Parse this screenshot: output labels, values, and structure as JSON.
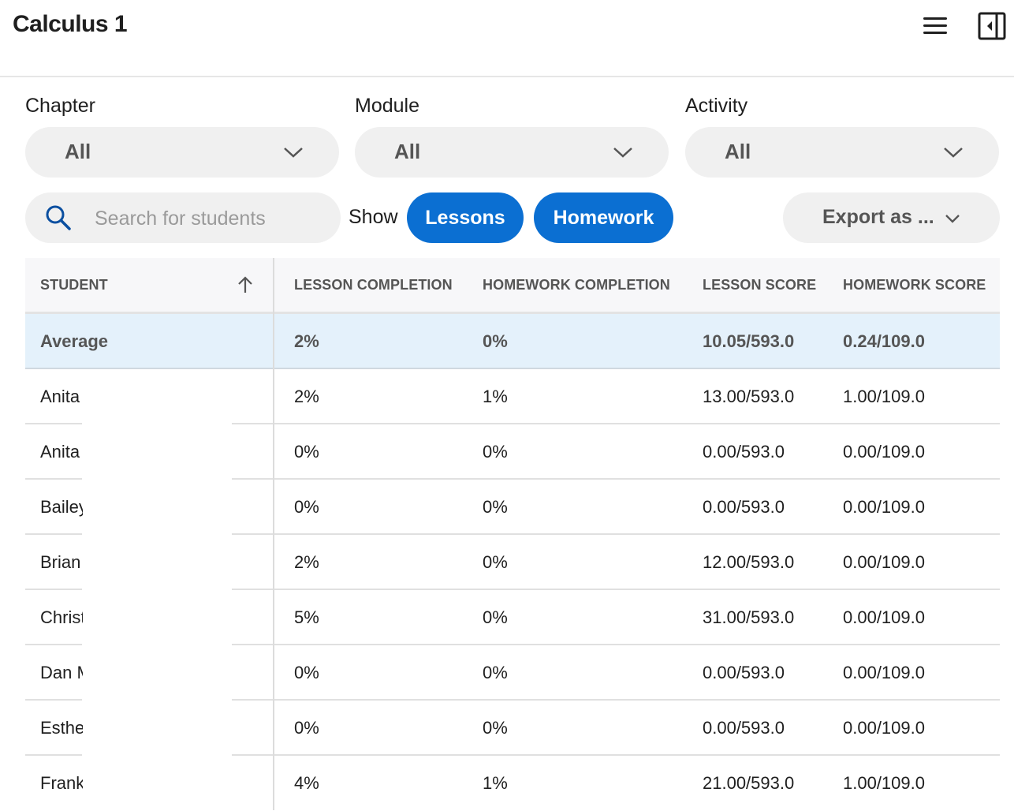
{
  "app": {
    "title": "Calculus 1"
  },
  "icons": {
    "menu": "hamburger-menu-icon",
    "panel": "collapse-panel-icon",
    "search": "search-icon",
    "sort": "arrow-up-icon",
    "chevron": "chevron-down-icon"
  },
  "filters": {
    "chapter": {
      "label": "Chapter",
      "value": "All"
    },
    "module": {
      "label": "Module",
      "value": "All"
    },
    "activity": {
      "label": "Activity",
      "value": "All"
    }
  },
  "search": {
    "placeholder": "Search for students"
  },
  "show": {
    "label": "Show",
    "lessons": "Lessons",
    "homework": "Homework"
  },
  "export": {
    "label": "Export as ..."
  },
  "colors": {
    "accent": "#0b6fd2",
    "average_row": "#e4f1fb"
  },
  "table": {
    "headers": {
      "student": "STUDENT",
      "lesson_completion": "LESSON COMPLETION",
      "homework_completion": "HOMEWORK COMPLETION",
      "lesson_score": "LESSON SCORE",
      "homework_score": "HOMEWORK SCORE"
    },
    "average": {
      "name": "Average",
      "lesson_completion": "2%",
      "homework_completion": "0%",
      "lesson_score": "10.05/593.0",
      "homework_score": "0.24/109.0"
    },
    "rows": [
      {
        "name": "Anita",
        "lesson_completion": "2%",
        "homework_completion": "1%",
        "lesson_score": "13.00/593.0",
        "homework_score": "1.00/109.0"
      },
      {
        "name": "Anita",
        "lesson_completion": "0%",
        "homework_completion": "0%",
        "lesson_score": "0.00/593.0",
        "homework_score": "0.00/109.0"
      },
      {
        "name": "Bailey",
        "lesson_completion": "0%",
        "homework_completion": "0%",
        "lesson_score": "0.00/593.0",
        "homework_score": "0.00/109.0"
      },
      {
        "name": "Brian",
        "lesson_completion": "2%",
        "homework_completion": "0%",
        "lesson_score": "12.00/593.0",
        "homework_score": "0.00/109.0"
      },
      {
        "name": "Christ",
        "lesson_completion": "5%",
        "homework_completion": "0%",
        "lesson_score": "31.00/593.0",
        "homework_score": "0.00/109.0"
      },
      {
        "name": "Dan M",
        "lesson_completion": "0%",
        "homework_completion": "0%",
        "lesson_score": "0.00/593.0",
        "homework_score": "0.00/109.0"
      },
      {
        "name": "Esthe",
        "lesson_completion": "0%",
        "homework_completion": "0%",
        "lesson_score": "0.00/593.0",
        "homework_score": "0.00/109.0"
      },
      {
        "name": "Frank",
        "lesson_completion": "4%",
        "homework_completion": "1%",
        "lesson_score": "21.00/593.0",
        "homework_score": "1.00/109.0"
      }
    ]
  }
}
